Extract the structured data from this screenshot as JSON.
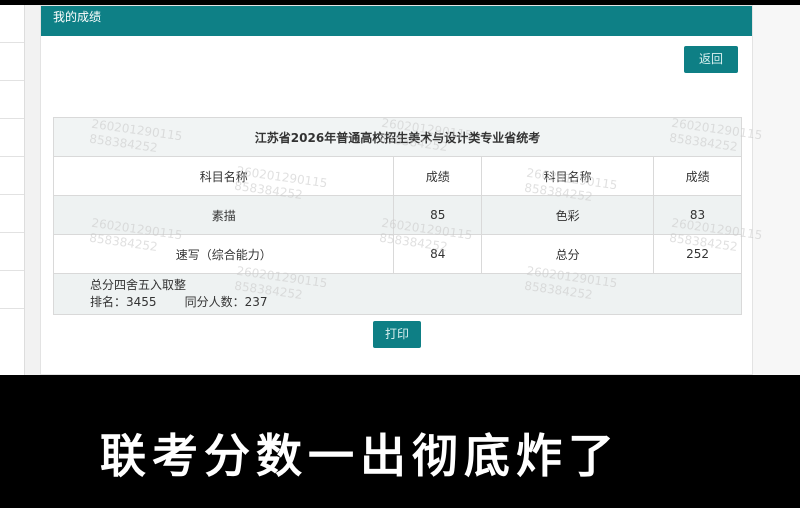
{
  "panel": {
    "header_title": "我的成绩",
    "back_label": "返回"
  },
  "table": {
    "title": "江苏省2026年普通高校招生美术与设计类专业省统考",
    "headers": [
      "科目名称",
      "成绩",
      "科目名称",
      "成绩"
    ],
    "rows": [
      [
        "素描",
        "85",
        "色彩",
        "83"
      ],
      [
        "速写（综合能力）",
        "84",
        "总分",
        "252"
      ]
    ],
    "note": "总分四舍五入取整",
    "rank_label": "排名：",
    "rank_value": "3455",
    "same_score_label": "同分人数：",
    "same_score_value": "237"
  },
  "print_label": "打印",
  "watermark": {
    "line1": "260201290115",
    "line2": "858384252"
  },
  "subtitle": "联考分数一出彻底炸了",
  "colors": {
    "accent": "#0e8086",
    "background": "#000000"
  }
}
